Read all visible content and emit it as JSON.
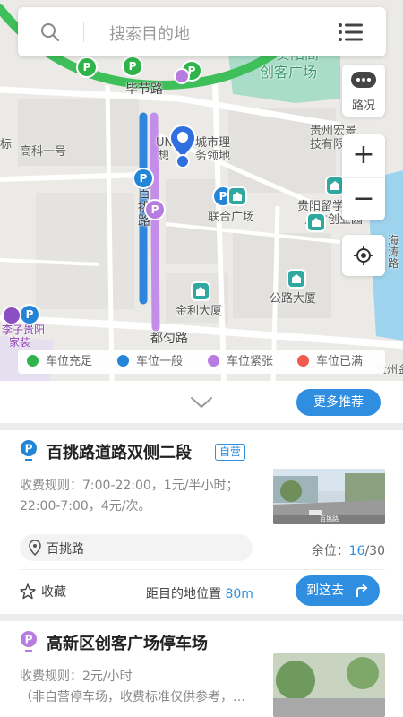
{
  "search": {
    "placeholder": "搜索目的地"
  },
  "map": {
    "traffic_label": "路况",
    "zoom_in": "+",
    "zoom_out": "−",
    "labels": {
      "bijie_road": "毕节路",
      "gaoxin_yihao": "高科一号",
      "biao": "标",
      "un_city_1": "UN",
      "un_city_2": "城市理",
      "un_city_3": "想",
      "un_city_4": "务领地",
      "baitiao_road_1": "百",
      "baitiao_road_2": "挑",
      "baitiao_road_3": "路",
      "lianhe_square": "联合广场",
      "guiyang_liuxue_1": "贵阳留学",
      "guiyang_liuxue_2": "人才创业园",
      "guizhou_hongfu_1": "贵州宏景",
      "guizhou_hongfu_2": "技有限",
      "jinli_building": "金利大厦",
      "gonglu_building": "公路大厦",
      "duyun_road": "都匀路",
      "chuangke_square_1": "贵阳高",
      "chuangke_square_2": "创客广场",
      "li_guiyang_1": "李子贵阳",
      "li_guiyang_2": "家装",
      "haihe_road": "海涛路",
      "guizhou_bottom": "贵州金"
    }
  },
  "legend": [
    {
      "label": "车位充足",
      "color": "#2fb44b"
    },
    {
      "label": "车位一般",
      "color": "#2485d6"
    },
    {
      "label": "车位紧张",
      "color": "#b67ce0"
    },
    {
      "label": "车位已满",
      "color": "#f05a4f"
    }
  ],
  "list": {
    "more_label": "更多推荐",
    "cards": [
      {
        "title": "百挑路道路双侧二段",
        "tag": "自营",
        "rule_line1": "收费规则：7:00-22:00，1元/半小时；",
        "rule_line2": "22:00-7:00，4元/次。",
        "address": "百挑路",
        "remain_label": "余位：",
        "remain_count": "16",
        "remain_total": "/30",
        "fav_label": "收藏",
        "dist_label": "距目的地位置",
        "dist_value": "80m",
        "go_label": "到这去",
        "thumb_caption": "百挑路"
      },
      {
        "title": "高新区创客广场停车场",
        "rule_line1": "收费规则：2元/小时",
        "rule_line2": "（非自营停车场，收费标准仅供参考，…"
      }
    ]
  }
}
